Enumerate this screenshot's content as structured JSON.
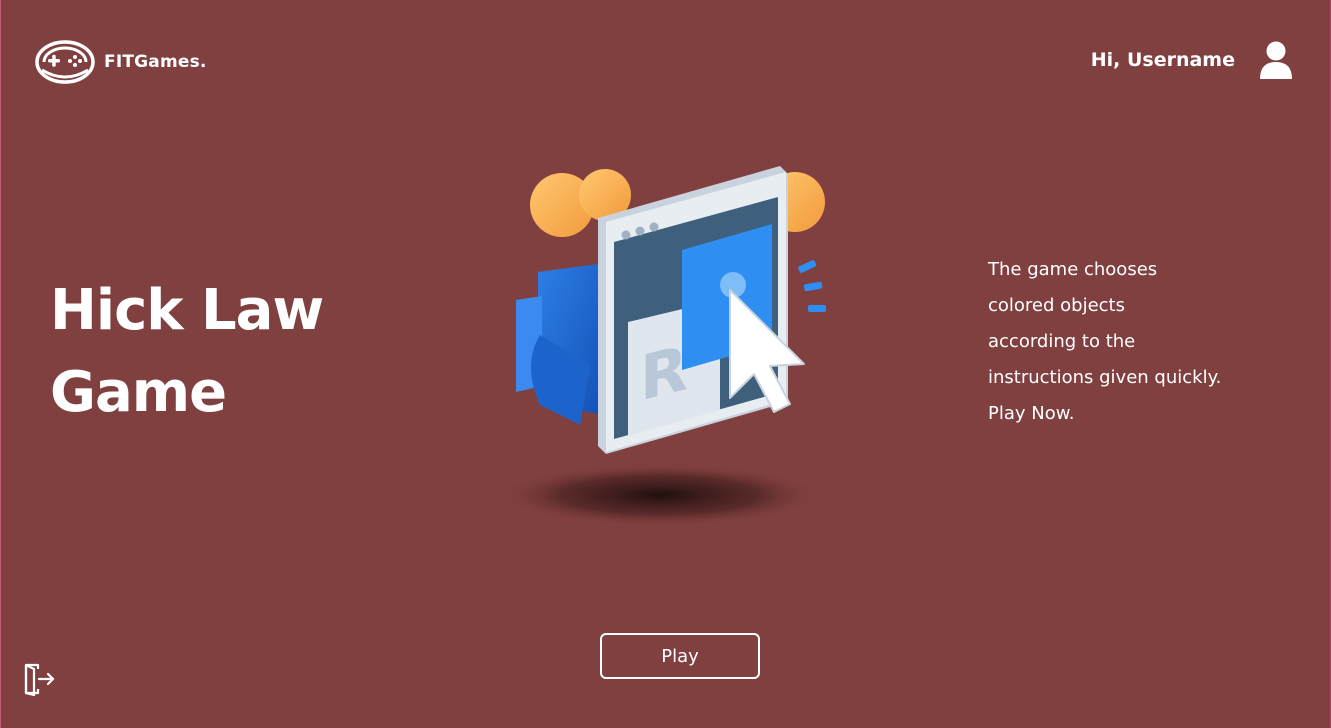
{
  "header": {
    "brand_name": "FITGames.",
    "brand_icon": "gamepad-icon",
    "greeting": "Hi, Username",
    "avatar_icon": "user-icon"
  },
  "main": {
    "title_line1": "Hick Law",
    "title_line2": "Game",
    "description_lines": [
      "The game chooses",
      "colored objects",
      "according to the",
      "instructions given quickly.",
      "Play Now."
    ],
    "hero_icon": "browser-click-illustration",
    "play_label": "Play"
  },
  "footer": {
    "logout_icon": "logout-icon"
  },
  "colors": {
    "background": "#814040",
    "text": "#ffffff",
    "accent_blue": "#2f8ef2",
    "accent_orange": "#f6b55a"
  }
}
